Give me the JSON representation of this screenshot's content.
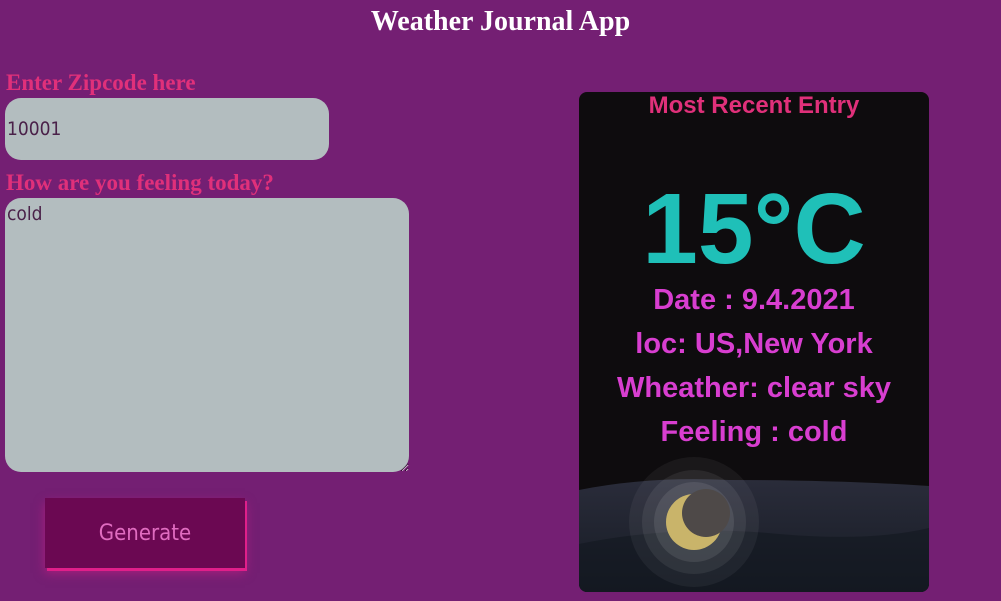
{
  "header": {
    "title": "Weather Journal App"
  },
  "form": {
    "zip_label": "Enter Zipcode here",
    "zip_value": "10001",
    "feelings_label": "How are you feeling today?",
    "feelings_value": "cold",
    "generate_label": "Generate"
  },
  "entry": {
    "title": "Most Recent Entry",
    "temp": "15°C",
    "date": "Date : 9.4.2021",
    "location": "loc: US,New York",
    "weather": "Wheather: clear sky",
    "feeling": "Feeling : cold",
    "scene_icon": "moon-icon"
  },
  "colors": {
    "background": "#741f73",
    "label": "#e0307a",
    "card_bg": "#0e0c0e",
    "temp": "#1fc0b8",
    "info": "#d83ed0",
    "input_bg": "#b3bdbf",
    "button_bg": "#6b0852",
    "moon": "#c9b46a"
  }
}
